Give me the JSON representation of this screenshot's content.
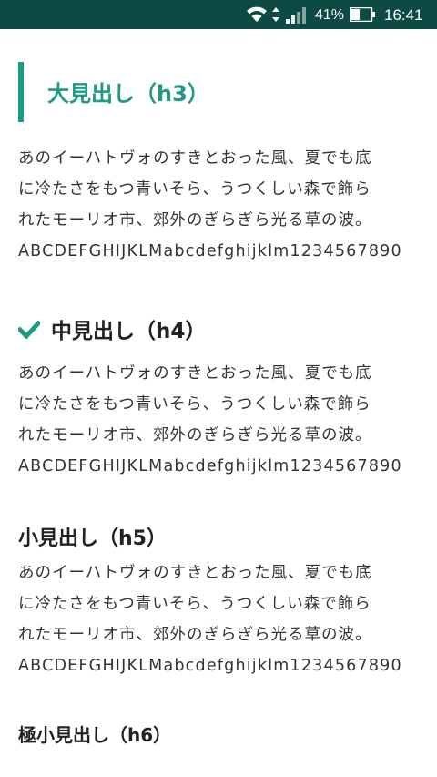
{
  "status_bar": {
    "battery_percent": "41%",
    "time": "16:41",
    "icons": [
      "wifi-icon",
      "data-arrows-icon",
      "signal-icon",
      "battery-icon"
    ]
  },
  "colors": {
    "status_bar_bg": "#0c4a43",
    "accent": "#1d9b85",
    "text": "#333333"
  },
  "headings": {
    "h3": "大見出し（h3）",
    "h4": "中見出し（h4）",
    "h5": "小見出し（h5）",
    "h6": "極小見出し（h6）"
  },
  "sample": {
    "line1": "あのイーハトヴォのすきとおった風、夏でも底",
    "line2": "に冷たさをもつ青いそら、うつくしい森で飾ら",
    "line3": "れたモーリオ市、郊外のぎらぎら光る草の波。",
    "alpha": "ABCDEFGHIJKLMabcdefghijklm1234567890"
  }
}
